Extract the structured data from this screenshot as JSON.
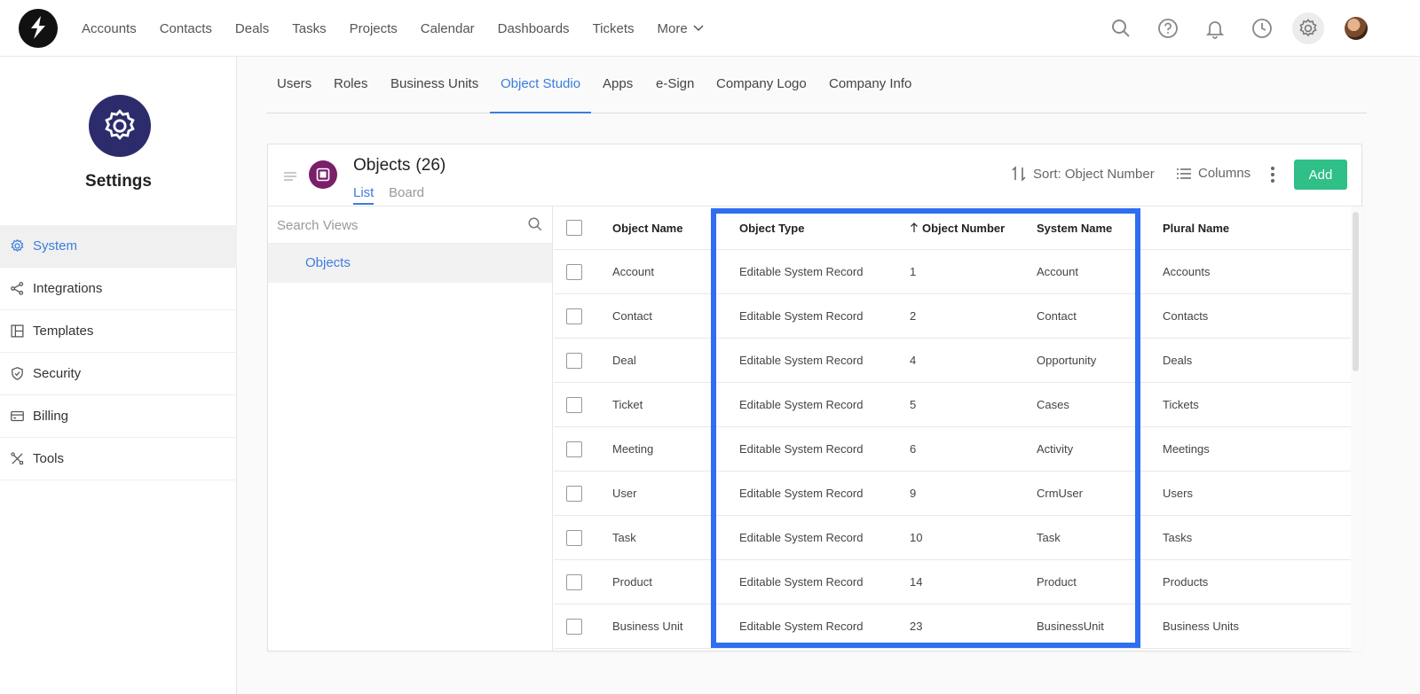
{
  "topnav": {
    "links": [
      "Accounts",
      "Contacts",
      "Deals",
      "Tasks",
      "Projects",
      "Calendar",
      "Dashboards",
      "Tickets"
    ],
    "more_label": "More"
  },
  "sidebar": {
    "title": "Settings",
    "items": [
      {
        "label": "System",
        "icon": "gear-icon"
      },
      {
        "label": "Integrations",
        "icon": "share-icon"
      },
      {
        "label": "Templates",
        "icon": "layout-icon"
      },
      {
        "label": "Security",
        "icon": "shield-icon"
      },
      {
        "label": "Billing",
        "icon": "card-icon"
      },
      {
        "label": "Tools",
        "icon": "tools-icon"
      }
    ]
  },
  "subtabs": [
    "Users",
    "Roles",
    "Business Units",
    "Object Studio",
    "Apps",
    "e-Sign",
    "Company Logo",
    "Company Info"
  ],
  "panel": {
    "title": "Objects",
    "count": "(26)",
    "view_tabs": [
      "List",
      "Board"
    ],
    "sort_label": "Sort: Object Number",
    "columns_label": "Columns",
    "add_label": "Add"
  },
  "views": {
    "search_placeholder": "Search Views",
    "items": [
      "Objects"
    ]
  },
  "table": {
    "headers": {
      "name": "Object Name",
      "type": "Object Type",
      "number": "Object Number",
      "system": "System Name",
      "plural": "Plural Name"
    },
    "rows": [
      {
        "name": "Account",
        "type": "Editable System Record",
        "number": "1",
        "system": "Account",
        "plural": "Accounts"
      },
      {
        "name": "Contact",
        "type": "Editable System Record",
        "number": "2",
        "system": "Contact",
        "plural": "Contacts"
      },
      {
        "name": "Deal",
        "type": "Editable System Record",
        "number": "4",
        "system": "Opportunity",
        "plural": "Deals"
      },
      {
        "name": "Ticket",
        "type": "Editable System Record",
        "number": "5",
        "system": "Cases",
        "plural": "Tickets"
      },
      {
        "name": "Meeting",
        "type": "Editable System Record",
        "number": "6",
        "system": "Activity",
        "plural": "Meetings"
      },
      {
        "name": "User",
        "type": "Editable System Record",
        "number": "9",
        "system": "CrmUser",
        "plural": "Users"
      },
      {
        "name": "Task",
        "type": "Editable System Record",
        "number": "10",
        "system": "Task",
        "plural": "Tasks"
      },
      {
        "name": "Product",
        "type": "Editable System Record",
        "number": "14",
        "system": "Product",
        "plural": "Products"
      },
      {
        "name": "Business Unit",
        "type": "Editable System Record",
        "number": "23",
        "system": "BusinessUnit",
        "plural": "Business Units"
      }
    ]
  },
  "colors": {
    "accent": "#3b7ddd",
    "add_button": "#2fbf87",
    "highlight": "#2f6ef0",
    "settings_badge": "#2c2c6c",
    "object_badge": "#7a1f6a"
  }
}
